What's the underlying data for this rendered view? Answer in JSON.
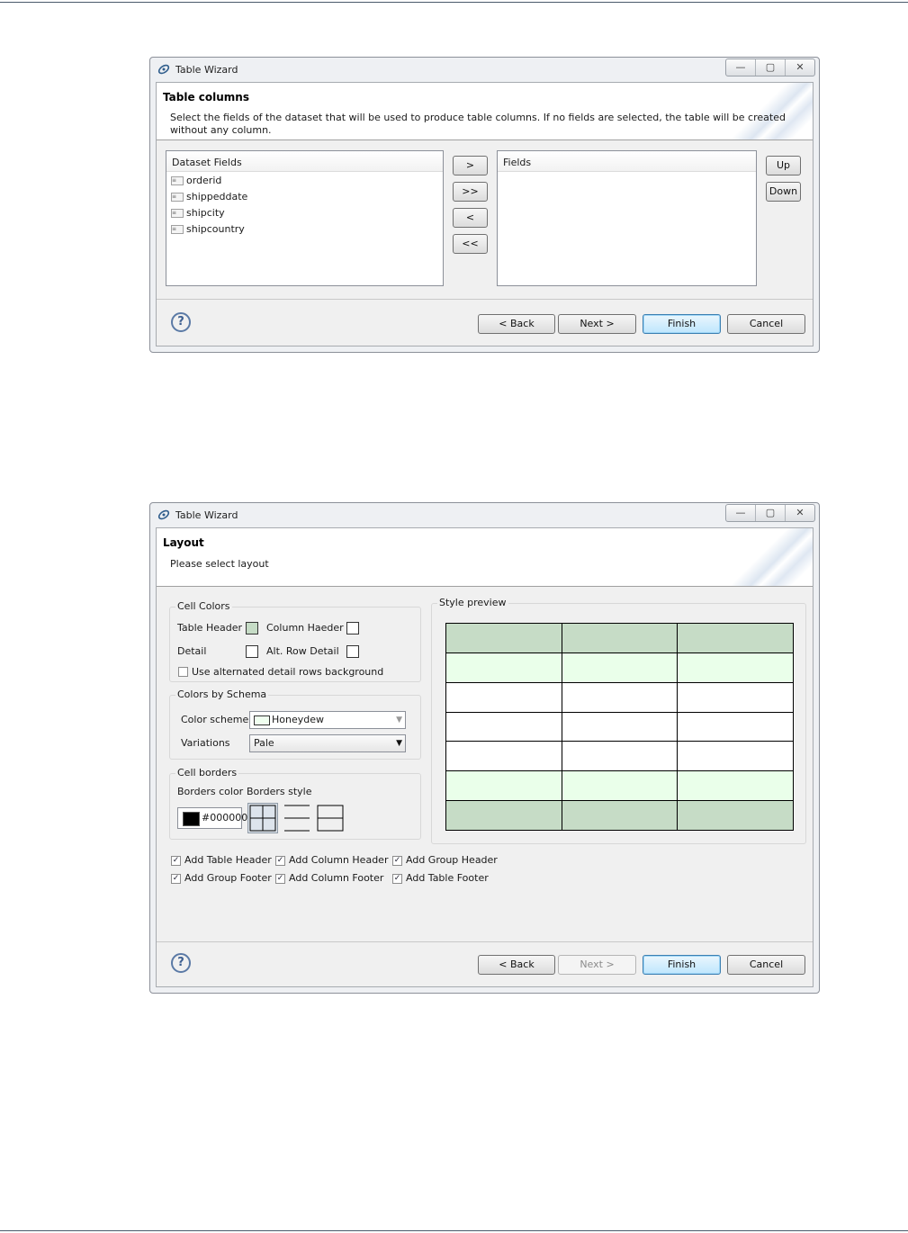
{
  "dialog1": {
    "title": "Table Wizard",
    "window_buttons": [
      "—",
      "▢",
      "✕"
    ],
    "heading": "Table columns",
    "description_line1": "Select the fields of the dataset that will be used to produce table columns. If no fields are selected, the table will be created",
    "description_line2": "without any column.",
    "dataset_fields_header": "Dataset Fields",
    "dataset_fields": [
      "orderid",
      "shippeddate",
      "shipcity",
      "shipcountry"
    ],
    "fields_header": "Fields",
    "move_buttons": [
      ">",
      ">>",
      "<",
      "<<"
    ],
    "up_label": "Up",
    "down_label": "Down",
    "back_label": "< Back",
    "next_label": "Next >",
    "finish_label": "Finish",
    "cancel_label": "Cancel",
    "help_glyph": "?"
  },
  "dialog2": {
    "title": "Table Wizard",
    "window_buttons": [
      "—",
      "▢",
      "✕"
    ],
    "heading": "Layout",
    "description": "Please select layout",
    "cell_colors": {
      "legend": "Cell Colors",
      "table_header_label": "Table Header",
      "column_header_label": "Column Haeder",
      "detail_label": "Detail",
      "alt_row_detail_label": "Alt. Row Detail",
      "use_alternated_label": "Use alternated detail rows background",
      "use_alternated_checked": false,
      "table_header_color": "#c6dcc6",
      "column_header_color": "#ffffff",
      "detail_color": "#ffffff",
      "alt_row_detail_color": "#ffffff"
    },
    "colors_by_schema": {
      "legend": "Colors by Schema",
      "color_scheme_label": "Color scheme",
      "color_scheme_value": "Honeydew",
      "color_scheme_swatch": "#f0fff0",
      "variations_label": "Variations",
      "variations_value": "Pale"
    },
    "cell_borders": {
      "legend": "Cell borders",
      "borders_color_label": "Borders color",
      "borders_style_label": "Borders style",
      "border_color_value": "#000000"
    },
    "style_preview": {
      "legend": "Style preview",
      "header_color": "#c6dcc6",
      "alt_color": "#eaffea",
      "detail_color": "#ffffff",
      "row_types": [
        "header",
        "alt",
        "detail",
        "detail",
        "detail",
        "alt",
        "header"
      ]
    },
    "options": [
      {
        "label": "Add Table Header",
        "checked": true
      },
      {
        "label": "Add Column Header",
        "checked": true
      },
      {
        "label": "Add Group Header",
        "checked": true
      },
      {
        "label": "Add Group Footer",
        "checked": true
      },
      {
        "label": "Add Column Footer",
        "checked": true
      },
      {
        "label": "Add Table Footer",
        "checked": true
      }
    ],
    "back_label": "< Back",
    "next_label": "Next >",
    "finish_label": "Finish",
    "cancel_label": "Cancel",
    "help_glyph": "?"
  }
}
